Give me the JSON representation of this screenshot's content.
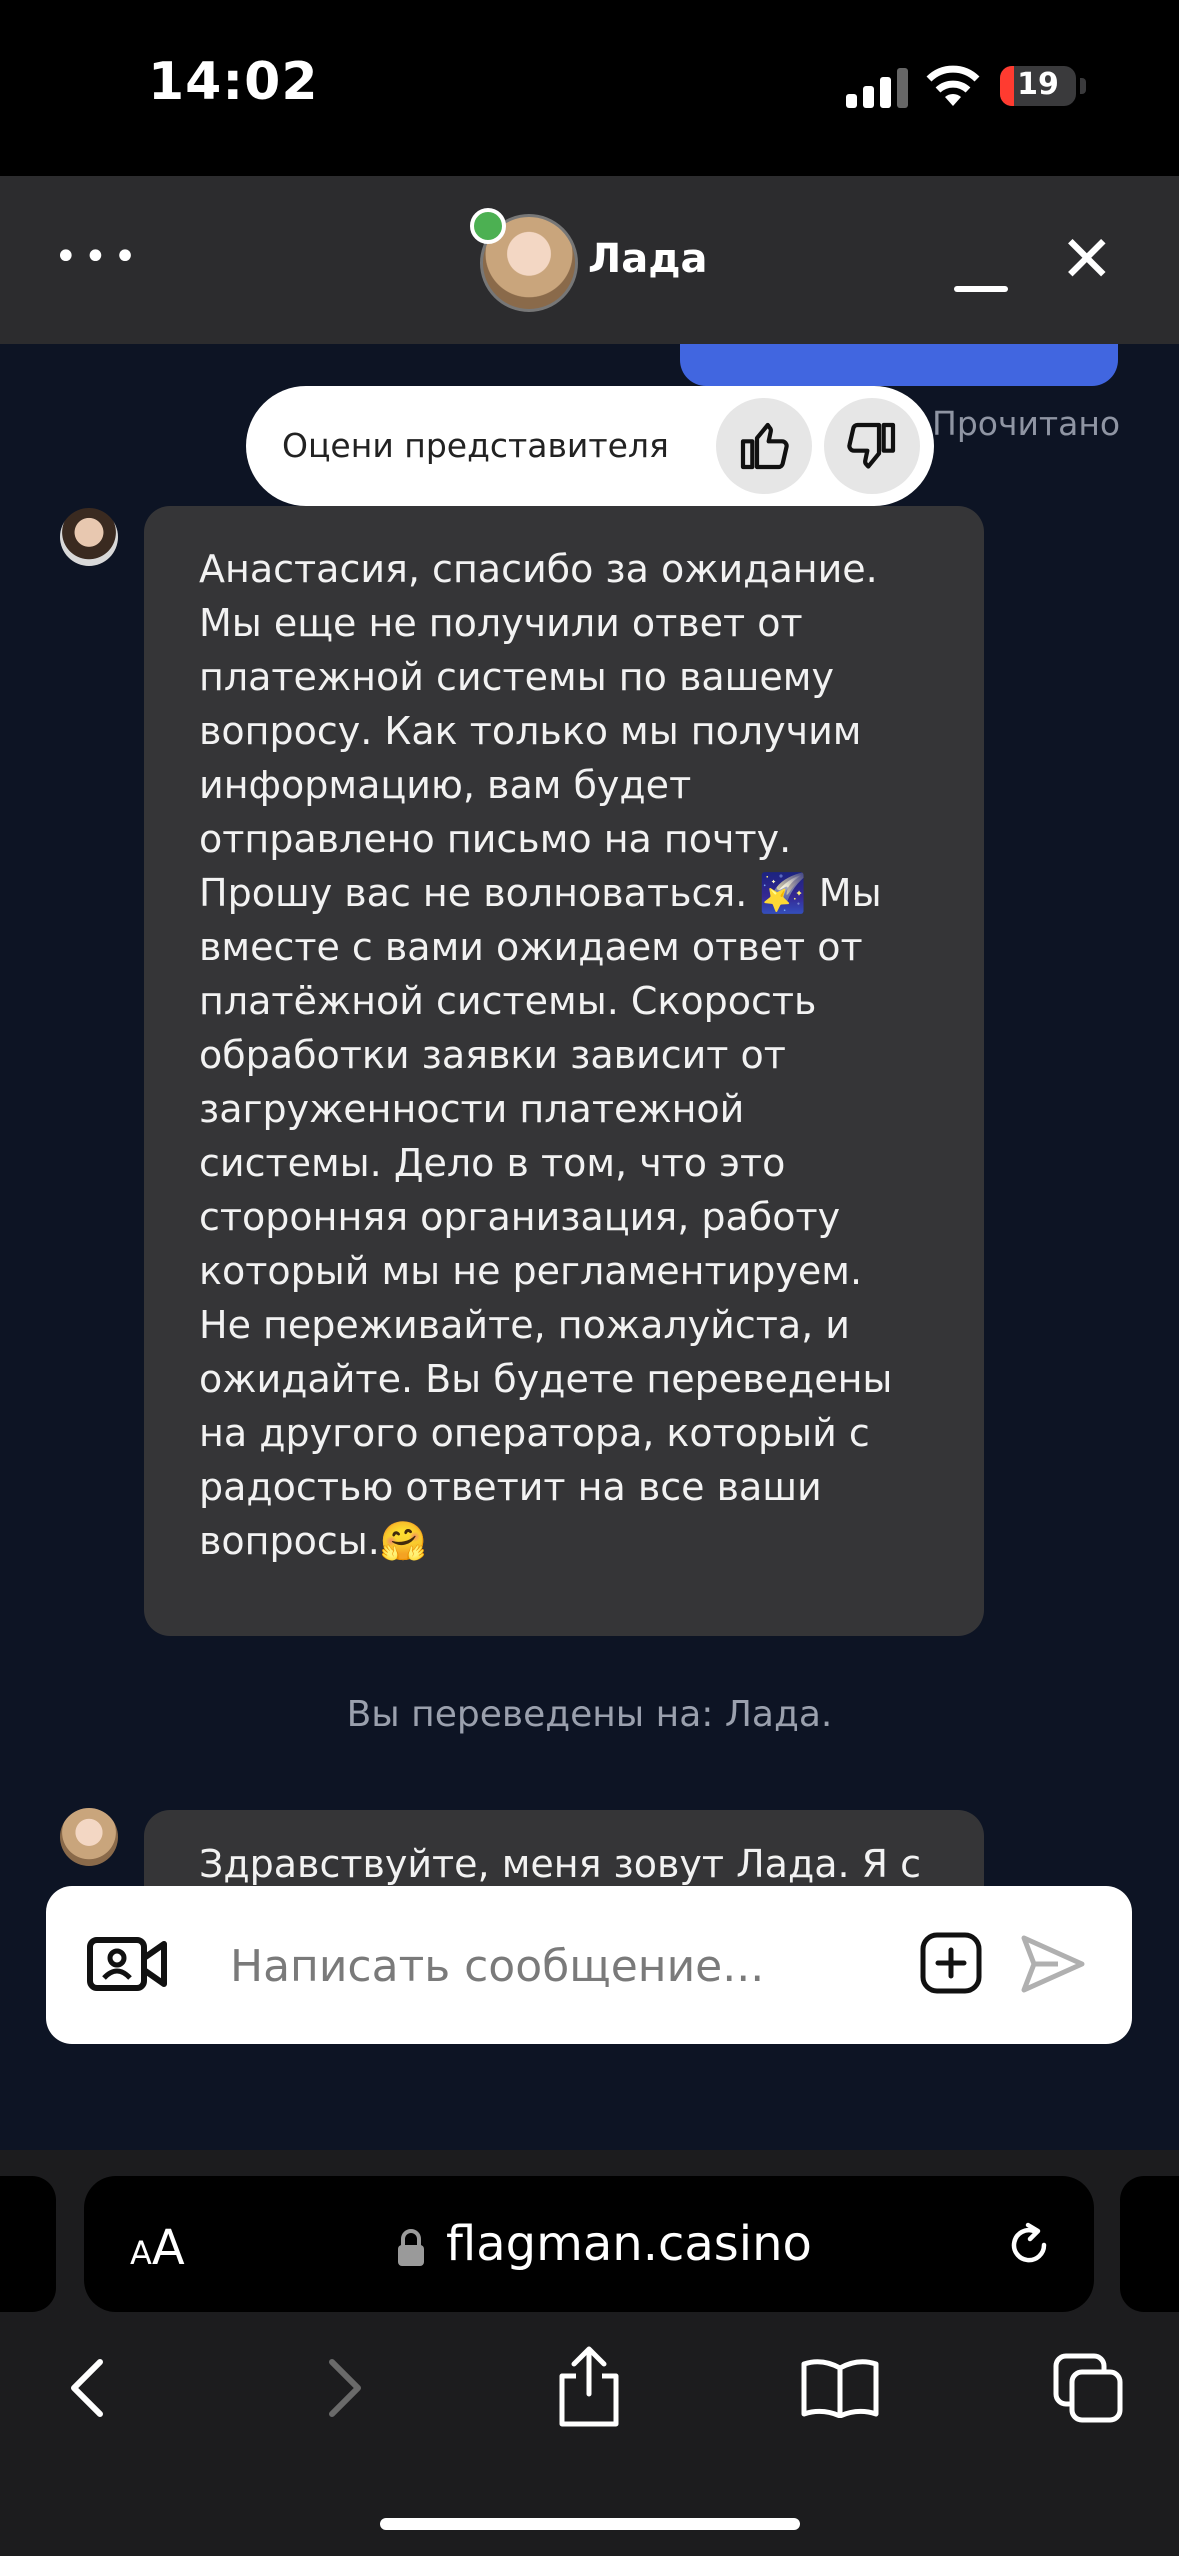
{
  "status_bar": {
    "time": "14:02",
    "battery": "19",
    "battery_level": 0.19
  },
  "header": {
    "menu_icon": "ellipsis-icon",
    "agent_name": "Лада",
    "online": true
  },
  "chat": {
    "read_status": "Прочитано",
    "rating_prompt": "Оцени представителя",
    "messages": [
      {
        "sender": "operator",
        "text": "Анастасия, спасибо за ожидание. Мы еще не получили ответ от платежной системы по вашему вопросу. Как только мы получим информацию, вам будет отправлено письмо на почту. Прошу вас не волноваться. 🌠 Мы вместе с вами ожидаем ответ от платёжной системы. Скорость обработки заявки зависит от загруженности платежной системы. Дело в том, что это сторонняя организация, работу который мы не регламентируем. Не переживайте, пожалуйста, и ожидайте. Вы будете переведены на другого оператора, который с радостью ответит на все ваши вопросы.🤗"
      },
      {
        "sender": "operator",
        "text": "Здравствуйте, меня зовут Лада. Я с"
      }
    ],
    "transfer_notice": "Вы переведены на: Лада."
  },
  "input": {
    "placeholder": "Написать сообщение..."
  },
  "browser": {
    "text_size_label_small": "A",
    "text_size_label_large": "A",
    "url": "flagman.casino"
  },
  "colors": {
    "accent": "#4166e0",
    "online": "#4cb052",
    "battery_low": "#ff3b30"
  }
}
